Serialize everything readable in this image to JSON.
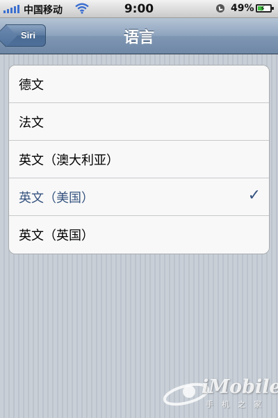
{
  "status_bar": {
    "carrier": "中国移动",
    "time": "9:00",
    "battery_percent": "49%",
    "battery_level": 0.49,
    "icons": [
      "signal-icon",
      "wifi-icon",
      "orientation-lock-icon",
      "battery-charging-icon"
    ]
  },
  "nav": {
    "back_label": "Siri",
    "title": "语言"
  },
  "languages": [
    {
      "label": "德文",
      "selected": false
    },
    {
      "label": "法文",
      "selected": false
    },
    {
      "label": "英文（澳大利亚）",
      "selected": false
    },
    {
      "label": "英文（美国）",
      "selected": true
    },
    {
      "label": "英文（英国）",
      "selected": false
    }
  ],
  "checkmark": "✓",
  "watermark": {
    "text": "iMobile",
    "sub": "手机之家"
  },
  "colors": {
    "selected_text": "#34527f",
    "nav_bar": "#8da3bd"
  }
}
